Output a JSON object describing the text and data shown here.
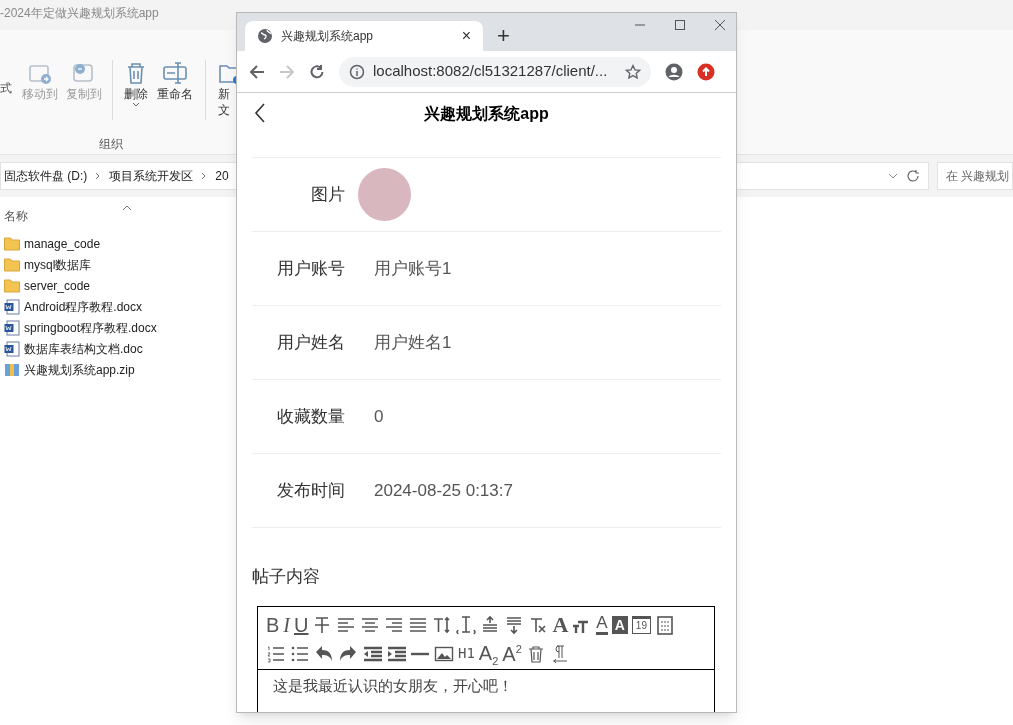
{
  "explorer": {
    "title": "-2024年定做兴趣规划系统app",
    "ribbon": {
      "cut_label": "式",
      "buttons": [
        {
          "kind": "move",
          "label": "移动到",
          "disabled": true
        },
        {
          "kind": "copy",
          "label": "复制到",
          "disabled": true
        },
        {
          "kind": "delete",
          "label": "删除",
          "disabled": false,
          "dropdown": true
        },
        {
          "kind": "rename",
          "label": "重命名",
          "disabled": false
        }
      ],
      "group_label": "组织",
      "new_button": {
        "lines": [
          "新",
          "文"
        ]
      }
    },
    "breadcrumbs": [
      "固态软件盘 (D:)",
      "项目系统开发区",
      "20"
    ],
    "search": {
      "placeholder": "在 兴趣规划"
    },
    "column": "名称",
    "files": [
      {
        "kind": "folder",
        "name": "manage_code"
      },
      {
        "kind": "folder",
        "name": "mysql数据库"
      },
      {
        "kind": "folder",
        "name": "server_code"
      },
      {
        "kind": "doc",
        "name": "Android程序教程.docx"
      },
      {
        "kind": "doc",
        "name": "springboot程序教程.docx"
      },
      {
        "kind": "doc",
        "name": "数据库表结构文档.doc"
      },
      {
        "kind": "zip",
        "name": "兴趣规划系统app.zip"
      }
    ]
  },
  "browser": {
    "tab": {
      "title": "兴趣规划系统app",
      "close": "×"
    },
    "new_tab": "+",
    "url": "localhost:8082/cl51321287/client/...",
    "forward_disabled": true,
    "page": {
      "title": "兴趣规划系统app",
      "fields": [
        {
          "kind": "image",
          "label": "图片"
        },
        {
          "kind": "text",
          "label": "用户账号",
          "value": "用户账号1"
        },
        {
          "kind": "text",
          "label": "用户姓名",
          "value": "用户姓名1"
        },
        {
          "kind": "text",
          "label": "收藏数量",
          "value": "0"
        },
        {
          "kind": "text",
          "label": "发布时间",
          "value": "2024-08-25 0:13:7"
        }
      ],
      "content_label": "帖子内容",
      "editor": {
        "toolbar": [
          [
            {
              "kind": "bold",
              "text": "B"
            },
            {
              "kind": "italic",
              "text": "I"
            },
            {
              "kind": "underline",
              "text": "U"
            },
            {
              "kind": "strike"
            },
            {
              "kind": "align-left"
            },
            {
              "kind": "align-center"
            },
            {
              "kind": "align-right"
            },
            {
              "kind": "justify"
            },
            {
              "kind": "font-size"
            },
            {
              "kind": "line-height"
            },
            {
              "kind": "space-before"
            },
            {
              "kind": "space-after"
            },
            {
              "kind": "clear-format"
            },
            {
              "kind": "letter",
              "text": "A"
            },
            {
              "kind": "small-caps"
            },
            {
              "kind": "forecolor",
              "text": "A"
            },
            {
              "kind": "backcolor",
              "text": "A"
            },
            {
              "kind": "date",
              "text": "19"
            },
            {
              "kind": "template"
            }
          ],
          [
            {
              "kind": "ordered-list"
            },
            {
              "kind": "bullet-list"
            },
            {
              "kind": "undo"
            },
            {
              "kind": "redo"
            },
            {
              "kind": "outdent"
            },
            {
              "kind": "indent"
            },
            {
              "kind": "rule"
            },
            {
              "kind": "image"
            },
            {
              "kind": "mono",
              "text": "H1"
            },
            {
              "kind": "sub",
              "text": "A",
              "script": "2"
            },
            {
              "kind": "sup",
              "text": "A",
              "script": "2"
            },
            {
              "kind": "trash"
            },
            {
              "kind": "pilcrow"
            }
          ]
        ],
        "content": "这是我最近认识的女朋友，开心吧！"
      }
    }
  }
}
